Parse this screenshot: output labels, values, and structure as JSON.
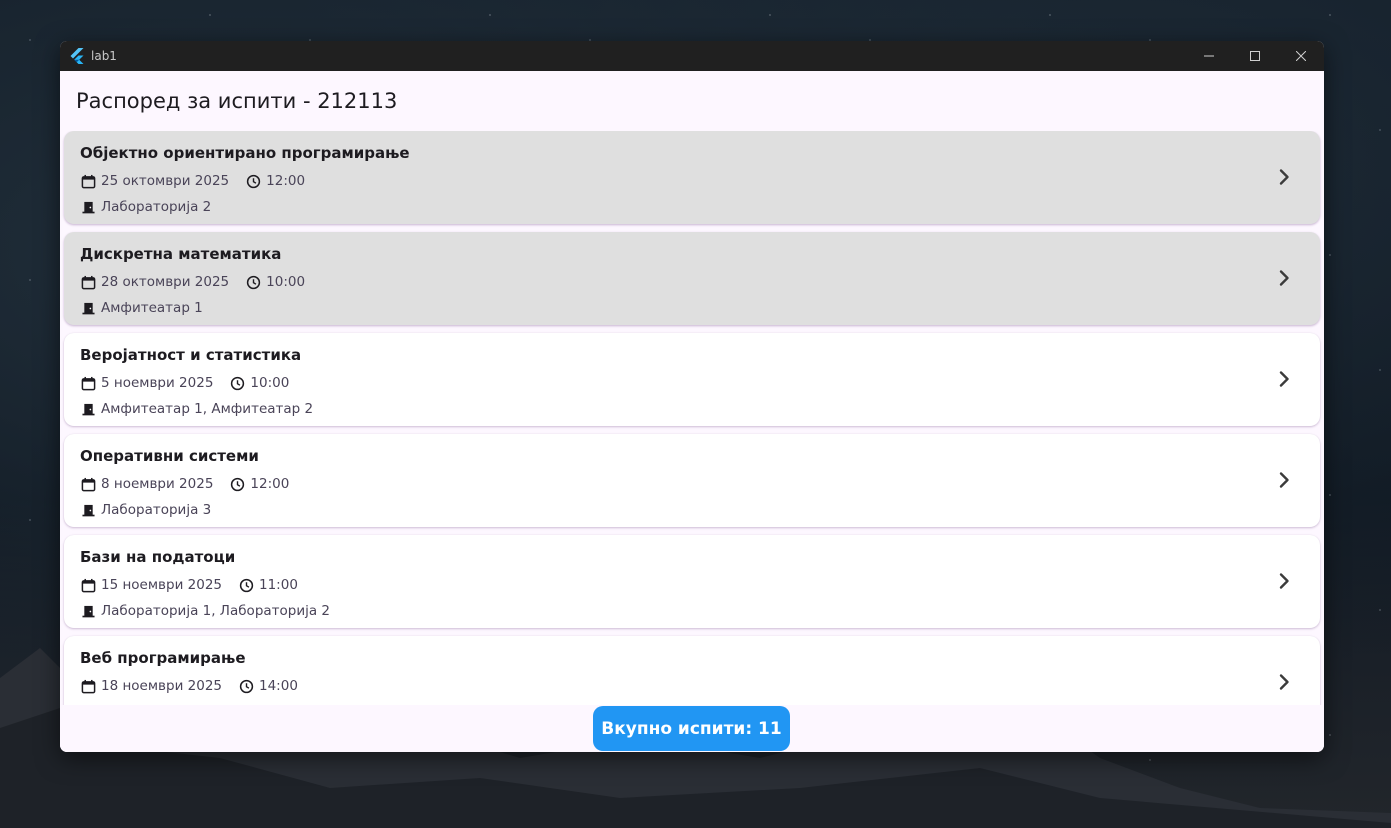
{
  "window": {
    "title": "lab1",
    "minimize_glyph": "—",
    "maximize_glyph": "☐",
    "close_glyph": "✕"
  },
  "appbar": {
    "title": "Распоред за испити - 212113"
  },
  "exams": [
    {
      "name": "Објектно ориентирано програмирање",
      "date": "25 октомври 2025",
      "time": "12:00",
      "rooms": "Лабораторија 2",
      "highlighted": true
    },
    {
      "name": "Дискретна математика",
      "date": "28 октомври 2025",
      "time": "10:00",
      "rooms": "Амфитеатар 1",
      "highlighted": true
    },
    {
      "name": "Веројатност и статистика",
      "date": "5 ноември 2025",
      "time": "10:00",
      "rooms": "Амфитеатар 1, Амфитеатар 2",
      "highlighted": false
    },
    {
      "name": "Оперативни системи",
      "date": "8 ноември 2025",
      "time": "12:00",
      "rooms": "Лабораторија 3",
      "highlighted": false
    },
    {
      "name": "Бази на податоци",
      "date": "15 ноември 2025",
      "time": "11:00",
      "rooms": "Лабораторија 1, Лабораторија 2",
      "highlighted": false
    },
    {
      "name": "Веб програмирање",
      "date": "18 ноември 2025",
      "time": "14:00",
      "rooms": "",
      "highlighted": false
    }
  ],
  "footer": {
    "total_label": "Вкупно испити: 11"
  },
  "colors": {
    "accent": "#2196f3",
    "highlight_card": "#dfdfdf",
    "background": "#fdf7ff"
  },
  "icons": {
    "calendar": "calendar-icon",
    "clock": "clock-icon",
    "room": "door-icon",
    "chevron": "chevron-right-icon"
  }
}
